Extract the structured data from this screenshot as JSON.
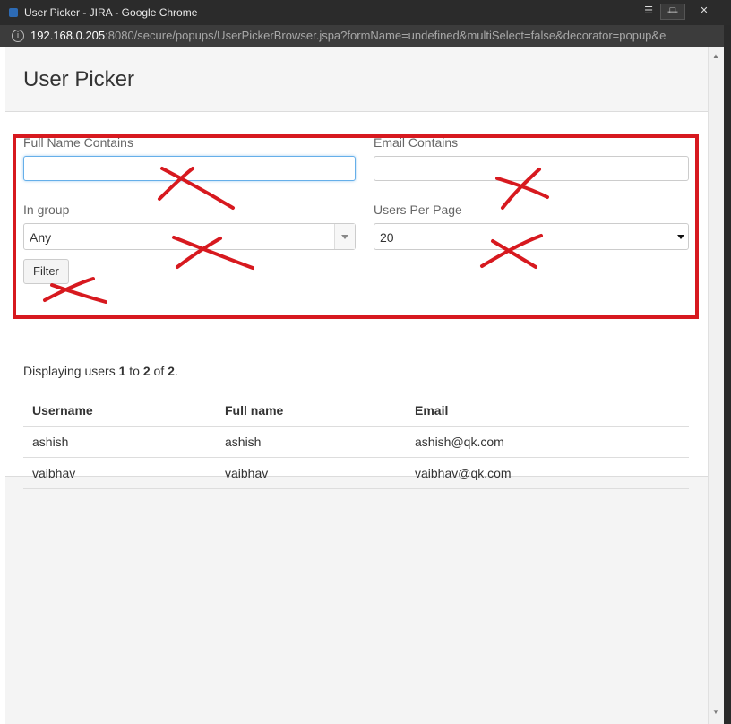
{
  "window": {
    "title": "User Picker - JIRA - Google Chrome",
    "url_host": "192.168.0.205",
    "url_path": ":8080/secure/popups/UserPickerBrowser.jspa?formName=undefined&multiSelect=false&decorator=popup&e"
  },
  "page": {
    "title": "User Picker"
  },
  "form": {
    "full_name_label": "Full Name Contains",
    "full_name_value": "",
    "email_label": "Email Contains",
    "email_value": "",
    "group_label": "In group",
    "group_value": "Any",
    "per_page_label": "Users Per Page",
    "per_page_value": "20",
    "filter_label": "Filter"
  },
  "summary": {
    "prefix": "Displaying users ",
    "from": "1",
    "to_word": " to ",
    "to": "2",
    "of_word": " of ",
    "total": "2",
    "suffix": "."
  },
  "table": {
    "headers": [
      "Username",
      "Full name",
      "Email"
    ],
    "rows": [
      [
        "ashish",
        "ashish",
        "ashish@qk.com"
      ],
      [
        "vaibhav",
        "vaibhav",
        "vaibhav@qk.com"
      ]
    ]
  },
  "colors": {
    "annotation_red": "#d7191f",
    "focus_blue": "#66afe9"
  }
}
